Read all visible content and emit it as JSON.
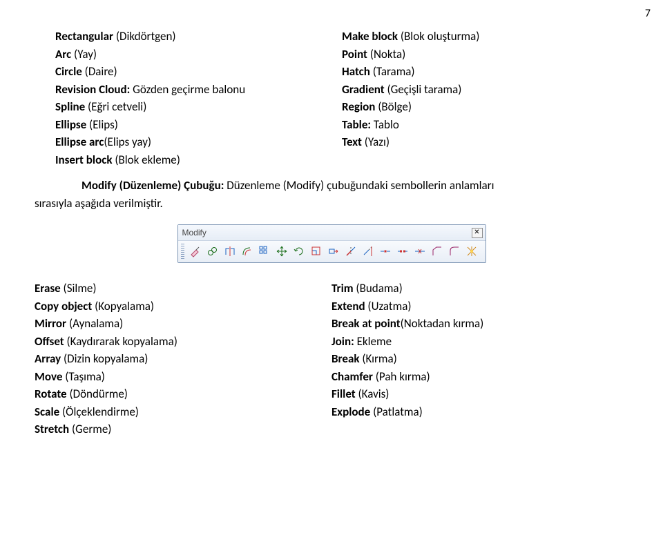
{
  "page_number": "7",
  "top_left": [
    {
      "b": "Rectangular",
      "t": " (Dikdörtgen)"
    },
    {
      "b": "Arc",
      "t": " (Yay)"
    },
    {
      "b": "Circle",
      "t": " (Daire)"
    },
    {
      "b": "Revision Cloud:",
      "t": " Gözden geçirme balonu"
    },
    {
      "b": "Spline",
      "t": " (Eğri cetveli)"
    },
    {
      "b": "Ellipse",
      "t": " (Elips)"
    },
    {
      "b": "Ellipse arc",
      "t": "(Elips yay)"
    },
    {
      "b": "Insert block",
      "t": " (Blok ekleme)"
    }
  ],
  "top_right": [
    {
      "b": "Make block",
      "t": " (Blok oluşturma)"
    },
    {
      "b": "Point",
      "t": " (Nokta)"
    },
    {
      "b": "Hatch",
      "t": " (Tarama)"
    },
    {
      "b": "Gradient",
      "t": " (Geçişli tarama)"
    },
    {
      "b": "Region",
      "t": " (Bölge)"
    },
    {
      "b": "Table:",
      "t": " Tablo"
    },
    {
      "b": "Text",
      "t": " (Yazı)"
    }
  ],
  "mid_para": {
    "lead_bold": "Modify (Düzenleme) Çubuğu:",
    "rest_line1": " Düzenleme (Modify) çubuğundaki sembollerin anlamları",
    "line2": "sırasıyla aşağıda verilmiştir."
  },
  "toolbar": {
    "title": "Modify",
    "close": "✕",
    "icons": [
      "erase-icon",
      "copy-icon",
      "mirror-icon",
      "offset-icon",
      "array-icon",
      "move-icon",
      "rotate-icon",
      "scale-icon",
      "stretch-icon",
      "trim-icon",
      "extend-icon",
      "break-at-point-icon",
      "break-icon",
      "join-icon",
      "chamfer-icon",
      "fillet-icon",
      "explode-icon"
    ]
  },
  "bottom_left": [
    {
      "b": "Erase",
      "t": " (Silme)"
    },
    {
      "b": "Copy object",
      "t": " (Kopyalama)"
    },
    {
      "b": "Mirror",
      "t": " (Aynalama)"
    },
    {
      "b": "Offset",
      "t": " (Kaydırarak kopyalama)"
    },
    {
      "b": "Array",
      "t": " (Dizin kopyalama)"
    },
    {
      "b": "Move",
      "t": " (Taşıma)"
    },
    {
      "b": "Rotate",
      "t": " (Döndürme)"
    },
    {
      "b": "Scale",
      "t": " (Ölçeklendirme)"
    },
    {
      "b": "Stretch",
      "t": " (Germe)"
    }
  ],
  "bottom_right": [
    {
      "b": "Trim",
      "t": " (Budama)"
    },
    {
      "b": "Extend",
      "t": " (Uzatma)"
    },
    {
      "b": "Break at point",
      "t": "(Noktadan kırma)"
    },
    {
      "b": "Join:",
      "t": " Ekleme"
    },
    {
      "b": "Break",
      "t": " (Kırma)"
    },
    {
      "b": "Chamfer",
      "t": " (Pah kırma)"
    },
    {
      "b": "Fillet",
      "t": " (Kavis)"
    },
    {
      "b": "Explode",
      "t": " (Patlatma)"
    }
  ]
}
